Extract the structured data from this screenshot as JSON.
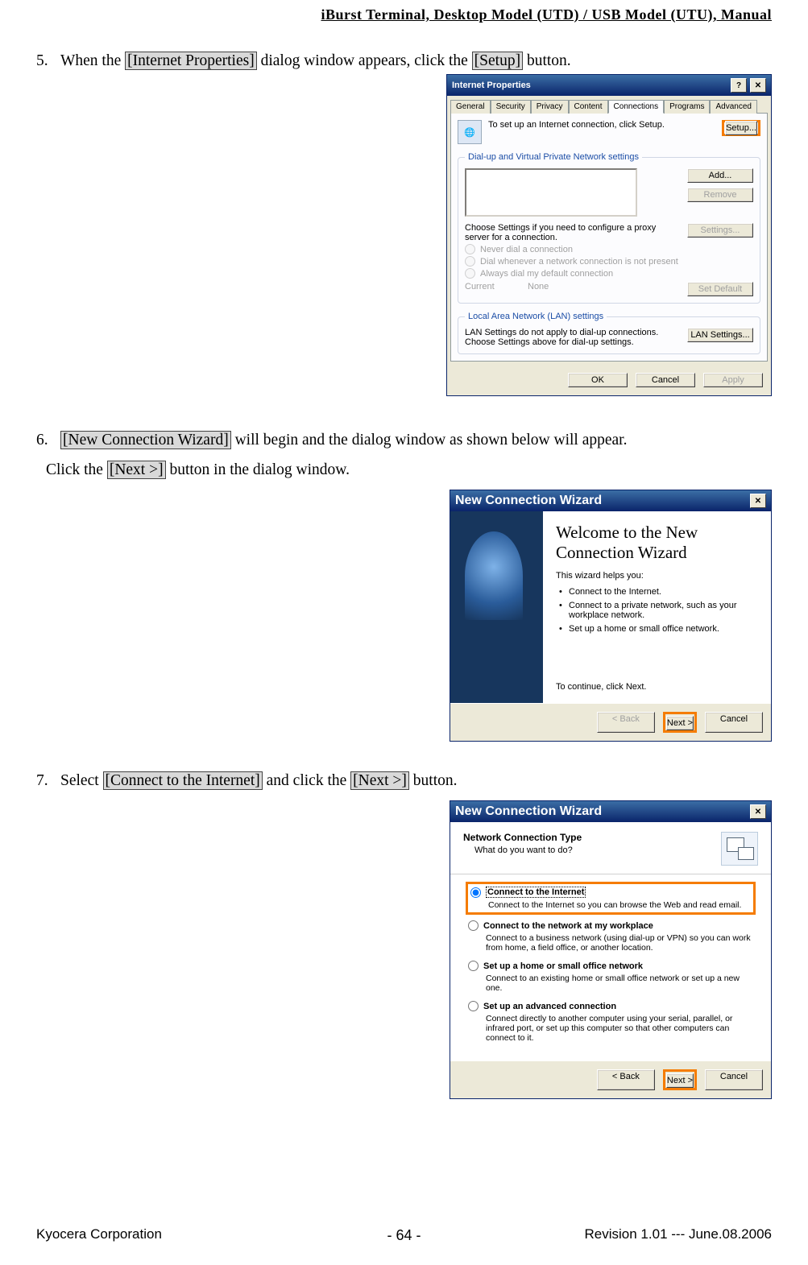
{
  "header": "iBurst Terminal, Desktop Model (UTD) / USB Model (UTU), Manual",
  "step5": {
    "num": "5.",
    "text_a": "When the ",
    "hl1": "[Internet Properties]",
    "text_b": " dialog window appears, click the ",
    "hl2": "[Setup]",
    "text_c": " button."
  },
  "step6": {
    "num": "6.",
    "hl1": "[New Connection Wizard]",
    "text_a": " will begin and the dialog window as shown below will appear.",
    "line2_a": "Click the ",
    "hl2": "[Next >]",
    "line2_b": " button in the dialog window."
  },
  "step7": {
    "num": "7.",
    "text_a": "Select ",
    "hl1": "[Connect to the Internet]",
    "text_b": " and click the ",
    "hl2": "[Next >]",
    "text_c": " button."
  },
  "ip_dialog": {
    "title": "Internet Properties",
    "tabs": [
      "General",
      "Security",
      "Privacy",
      "Content",
      "Connections",
      "Programs",
      "Advanced"
    ],
    "setup_text": "To set up an Internet connection, click Setup.",
    "setup_btn": "Setup...",
    "fs1_legend": "Dial-up and Virtual Private Network settings",
    "add_btn": "Add...",
    "remove_btn": "Remove",
    "settings_hint": "Choose Settings if you need to configure a proxy server for a connection.",
    "settings_btn": "Settings...",
    "radio1": "Never dial a connection",
    "radio2": "Dial whenever a network connection is not present",
    "radio3": "Always dial my default connection",
    "current_lbl": "Current",
    "current_val": "None",
    "setdefault_btn": "Set Default",
    "fs2_legend": "Local Area Network (LAN) settings",
    "lan_text": "LAN Settings do not apply to dial-up connections. Choose Settings above for dial-up settings.",
    "lan_btn": "LAN Settings...",
    "ok": "OK",
    "cancel": "Cancel",
    "apply": "Apply"
  },
  "wiz1": {
    "title": "New Connection Wizard",
    "welcome": "Welcome to the New Connection Wizard",
    "helps": "This wizard helps you:",
    "b1": "Connect to the Internet.",
    "b2": "Connect to a private network, such as your workplace network.",
    "b3": "Set up a home or small office network.",
    "continue": "To continue, click Next.",
    "back": "< Back",
    "next": "Next >",
    "cancel": "Cancel"
  },
  "wiz2": {
    "title": "New Connection Wizard",
    "h": "Network Connection Type",
    "sub": "What do you want to do?",
    "o1": "Connect to the Internet",
    "o1d": "Connect to the Internet so you can browse the Web and read email.",
    "o2": "Connect to the network at my workplace",
    "o2d": "Connect to a business network (using dial-up or VPN) so you can work from home, a field office, or another location.",
    "o3": "Set up a home or small office network",
    "o3d": "Connect to an existing home or small office network or set up a new one.",
    "o4": "Set up an advanced connection",
    "o4d": "Connect directly to another computer using your serial, parallel, or infrared port, or set up this computer so that other computers can connect to it.",
    "back": "< Back",
    "next": "Next >",
    "cancel": "Cancel"
  },
  "footer": {
    "left": "Kyocera Corporation",
    "center": "- 64 -",
    "right": "Revision 1.01 --- June.08.2006"
  }
}
